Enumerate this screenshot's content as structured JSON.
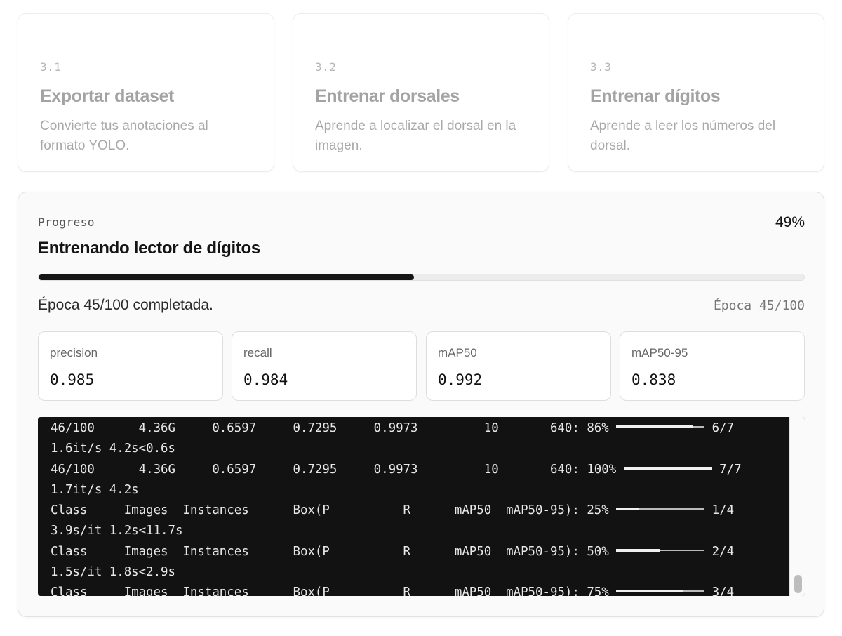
{
  "steps": [
    {
      "number": "3.1",
      "title": "Exportar dataset",
      "description": "Convierte tus anotaciones al formato YOLO."
    },
    {
      "number": "3.2",
      "title": "Entrenar dorsales",
      "description": "Aprende a localizar el dorsal en la imagen."
    },
    {
      "number": "3.3",
      "title": "Entrenar dígitos",
      "description": "Aprende a leer los números del dorsal."
    }
  ],
  "progress": {
    "label": "Progreso",
    "percent_text": "49%",
    "bar_fraction": 0.49,
    "title": "Entrenando lector de dígitos",
    "status": "Época 45/100 completada.",
    "epoch_counter": "Época 45/100"
  },
  "metrics": [
    {
      "label": "precision",
      "value": "0.985"
    },
    {
      "label": "recall",
      "value": "0.984"
    },
    {
      "label": "mAP50",
      "value": "0.992"
    },
    {
      "label": "mAP50-95",
      "value": "0.838"
    }
  ],
  "terminal": {
    "entries": [
      {
        "head": "46/100      4.36G     0.6597     0.7295     0.9973         10       640: 86% ",
        "bar_fraction": 0.86,
        "tail": " 6/7",
        "line2": "1.6it/s 4.2s<0.6s"
      },
      {
        "head": "46/100      4.36G     0.6597     0.7295     0.9973         10       640: 100% ",
        "bar_fraction": 1.0,
        "tail": " 7/7",
        "line2": "1.7it/s 4.2s"
      },
      {
        "head": "Class     Images  Instances      Box(P          R      mAP50  mAP50-95): 25% ",
        "bar_fraction": 0.25,
        "tail": " 1/4",
        "line2": "3.9s/it 1.2s<11.7s"
      },
      {
        "head": "Class     Images  Instances      Box(P          R      mAP50  mAP50-95): 50% ",
        "bar_fraction": 0.5,
        "tail": " 2/4",
        "line2": "1.5s/it 1.8s<2.9s"
      },
      {
        "head": "Class     Images  Instances      Box(P          R      mAP50  mAP50-95): 75% ",
        "bar_fraction": 0.75,
        "tail": " 3/4",
        "line2": ""
      }
    ]
  }
}
